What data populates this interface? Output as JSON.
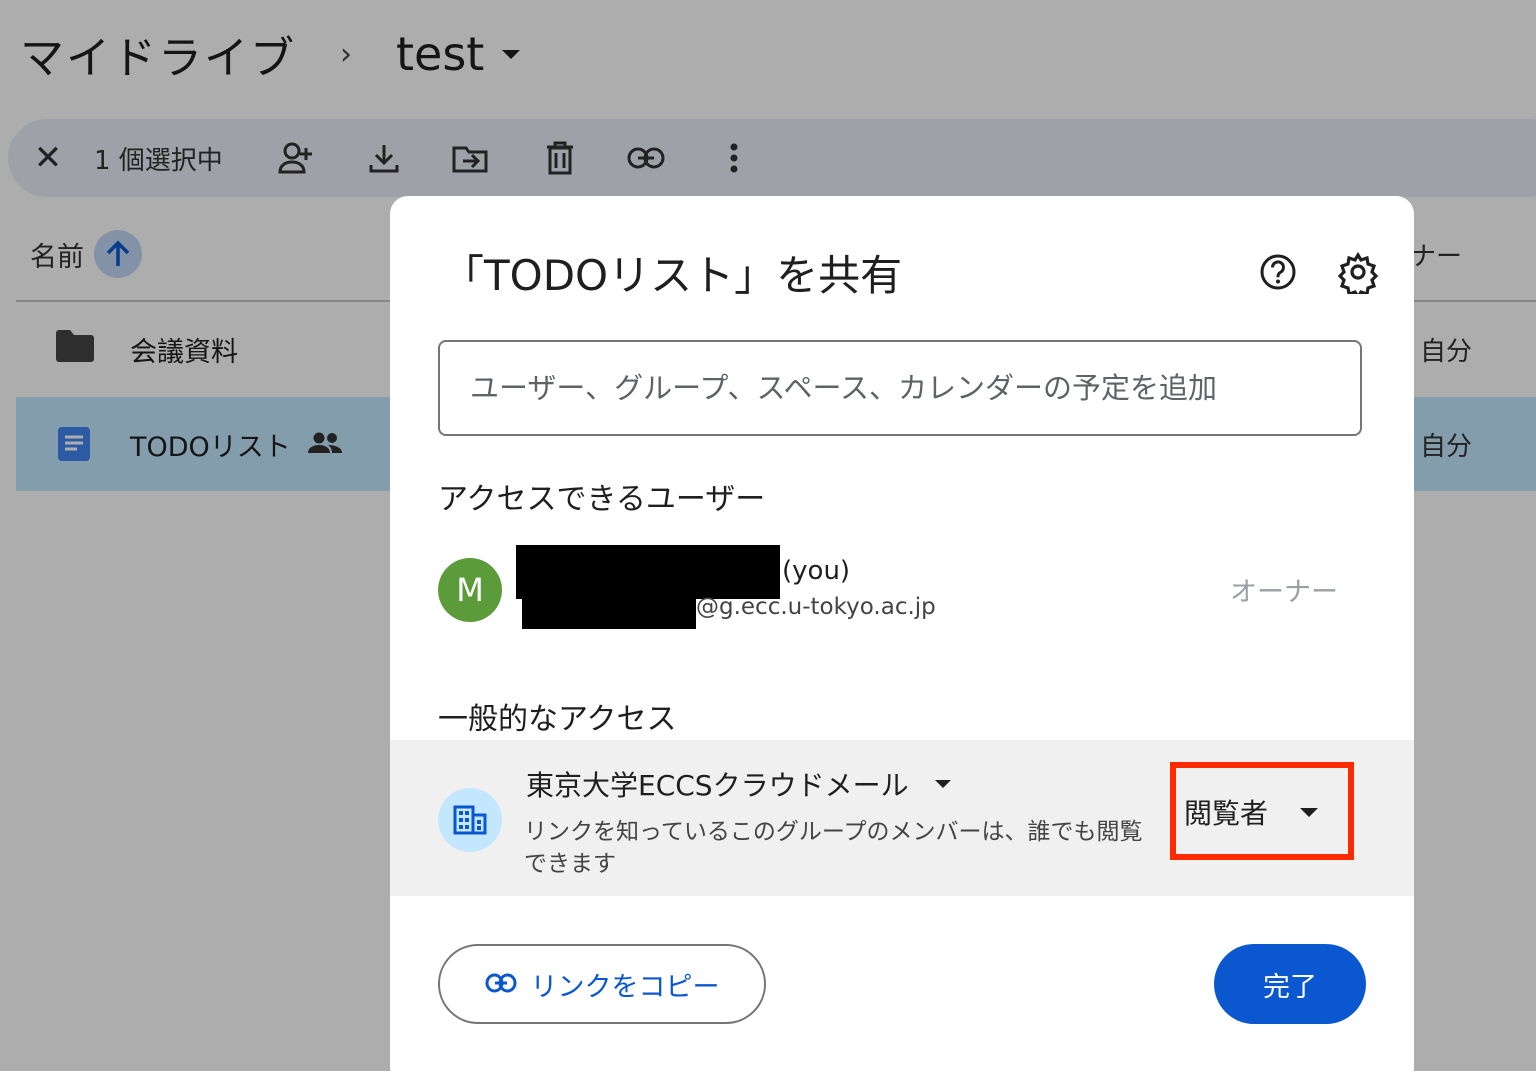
{
  "breadcrumb": {
    "root": "マイドライブ",
    "separator": "›",
    "current": "test"
  },
  "action_bar": {
    "selection_count": "1 個選択中",
    "close_label": "✕"
  },
  "file_list": {
    "name_header": "名前",
    "owner_header": "ナー",
    "rows": [
      {
        "name": "会議資料",
        "owner": "自分",
        "type": "folder"
      },
      {
        "name": "TODOリスト",
        "owner": "自分",
        "type": "doc",
        "selected": true
      }
    ]
  },
  "dialog": {
    "title": "「TODOリスト」を共有",
    "input_placeholder": "ユーザー、グループ、スペース、カレンダーの予定を追加",
    "people_section": "アクセスできるユーザー",
    "user": {
      "avatar_letter": "M",
      "you": "(you)",
      "email_suffix": "@g.ecc.u-tokyo.ac.jp",
      "role": "オーナー"
    },
    "general_section": "一般的なアクセス",
    "access": {
      "org": "東京大学ECCSクラウドメール",
      "description": "リンクを知っているこのグループのメンバーは、誰でも閲覧できます",
      "role": "閲覧者"
    },
    "copy_link": "リンクをコピー",
    "done": "完了"
  },
  "colors": {
    "accent": "#0b57d0",
    "highlight_box": "#ff2a00",
    "avatar": "#5c9b3a",
    "selected_row": "#c2e7ff"
  }
}
